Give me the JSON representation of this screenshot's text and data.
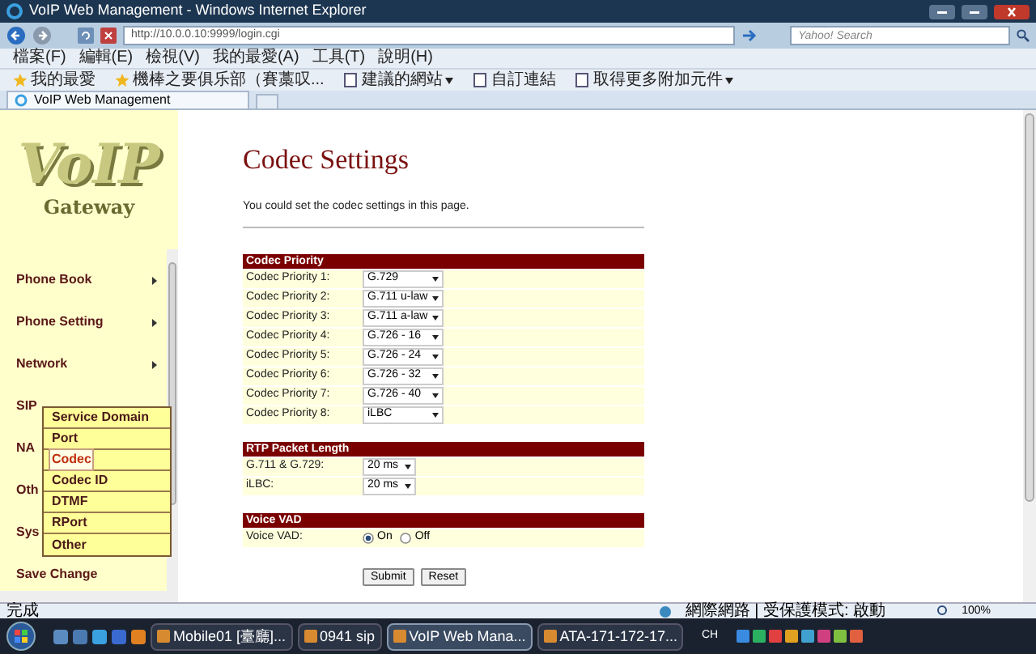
{
  "window": {
    "title": "VoIP Web Management - Windows Internet Explorer"
  },
  "address_bar": {
    "url": "http://10.0.0.10:9999/login.cgi"
  },
  "search": {
    "placeholder": "Yahoo! Search"
  },
  "menu_bar": [
    "檔案(F)",
    "編輯(E)",
    "檢視(V)",
    "我的最愛(A)",
    "工具(T)",
    "說明(H)"
  ],
  "favorites_bar": [
    {
      "label": "我的最愛",
      "dropdown": false
    },
    {
      "label": "機棒之要俱乐部（賽藁叹...",
      "dropdown": false
    },
    {
      "label": "建議的網站",
      "dropdown": true
    },
    {
      "label": "自訂連結",
      "dropdown": false
    },
    {
      "label": "取得更多附加元件",
      "dropdown": true
    }
  ],
  "tabs": [
    {
      "label": "VoIP Web Management",
      "selected": true
    }
  ],
  "sidebar": {
    "logo": {
      "title": "VoIP",
      "subtitle": "Gateway"
    },
    "items": [
      {
        "label": "Phone Book",
        "has_submenu": true
      },
      {
        "label": "Phone Setting",
        "has_submenu": true
      },
      {
        "label": "Network",
        "has_submenu": true
      },
      {
        "label": "SIP",
        "has_submenu": false
      },
      {
        "label": "NA",
        "has_submenu": false
      },
      {
        "label": "Oth",
        "has_submenu": false
      },
      {
        "label": "Sys",
        "has_submenu": false
      },
      {
        "label": "Save Change",
        "has_submenu": false
      }
    ],
    "submenu": [
      {
        "label": "Service Domain",
        "selected": false
      },
      {
        "label": "Port",
        "selected": false
      },
      {
        "label": "Codec",
        "selected": true
      },
      {
        "label": "Codec ID",
        "selected": false
      },
      {
        "label": "DTMF",
        "selected": false
      },
      {
        "label": "RPort",
        "selected": false
      },
      {
        "label": "Other",
        "selected": false
      }
    ]
  },
  "page": {
    "title": "Codec Settings",
    "description": "You could set the codec settings in this page.",
    "sections": [
      {
        "title": "Codec Priority",
        "rows": [
          {
            "label": "Codec Priority 1:",
            "kind": "select",
            "value": "G.729"
          },
          {
            "label": "Codec Priority 2:",
            "kind": "select",
            "value": "G.711 u-law"
          },
          {
            "label": "Codec Priority 3:",
            "kind": "select",
            "value": "G.711 a-law"
          },
          {
            "label": "Codec Priority 4:",
            "kind": "select",
            "value": "G.726 - 16"
          },
          {
            "label": "Codec Priority 5:",
            "kind": "select",
            "value": "G.726 - 24"
          },
          {
            "label": "Codec Priority 6:",
            "kind": "select",
            "value": "G.726 - 32"
          },
          {
            "label": "Codec Priority 7:",
            "kind": "select",
            "value": "G.726 - 40"
          },
          {
            "label": "Codec Priority 8:",
            "kind": "select",
            "value": "iLBC"
          }
        ]
      },
      {
        "title": "RTP Packet Length",
        "rows": [
          {
            "label": "G.711 & G.729:",
            "kind": "select_small",
            "value": "20 ms"
          },
          {
            "label": "iLBC:",
            "kind": "select_small",
            "value": "20 ms"
          }
        ]
      },
      {
        "title": "Voice VAD",
        "rows": [
          {
            "label": "Voice VAD:",
            "kind": "radio",
            "options": [
              {
                "label": "On",
                "selected": true
              },
              {
                "label": "Off",
                "selected": false
              }
            ]
          }
        ]
      }
    ],
    "buttons": [
      "Submit",
      "Reset"
    ]
  },
  "status_bar": {
    "text": "完成",
    "zone": "網際網路 | 受保護模式: 啟動",
    "zoom": "100%"
  },
  "taskbar": {
    "items": [
      {
        "label": "Mobile01 [臺廳]...",
        "selected": false
      },
      {
        "label": "0941 sip",
        "selected": false
      },
      {
        "label": "VoIP Web Mana...",
        "selected": true
      },
      {
        "label": "ATA-171-172-17...",
        "selected": false
      }
    ],
    "language": "CH"
  }
}
